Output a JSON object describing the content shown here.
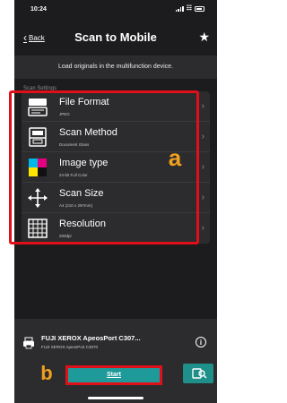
{
  "status_bar": {
    "time": "10:24"
  },
  "nav": {
    "back_label": "Back",
    "title": "Scan to Mobile"
  },
  "instruction": "Load originals in the multifunction device.",
  "section_label": "Scan Settings",
  "settings": [
    {
      "title": "File Format",
      "value": "JPEG",
      "icon": "file-format-icon"
    },
    {
      "title": "Scan Method",
      "value": "Document Glass",
      "icon": "scan-method-icon"
    },
    {
      "title": "Image type",
      "value": "24-bit Full Color",
      "icon": "image-type-icon"
    },
    {
      "title": "Scan Size",
      "value": "A4 (210 x 297mm)",
      "icon": "scan-size-icon"
    },
    {
      "title": "Resolution",
      "value": "200dpi",
      "icon": "resolution-icon"
    }
  ],
  "annotations": {
    "a": "a",
    "b": "b",
    "highlight_color": "#e0101a",
    "label_color": "#f0a020"
  },
  "device": {
    "name": "FUJI XEROX ApeosPort C307...",
    "model": "FUJI XEROX ApeosPort C3070"
  },
  "actions": {
    "start_label": "Start"
  },
  "colors": {
    "background": "#1c1c1e",
    "panel": "#2c2c2e",
    "accent": "#1f9a9a"
  }
}
